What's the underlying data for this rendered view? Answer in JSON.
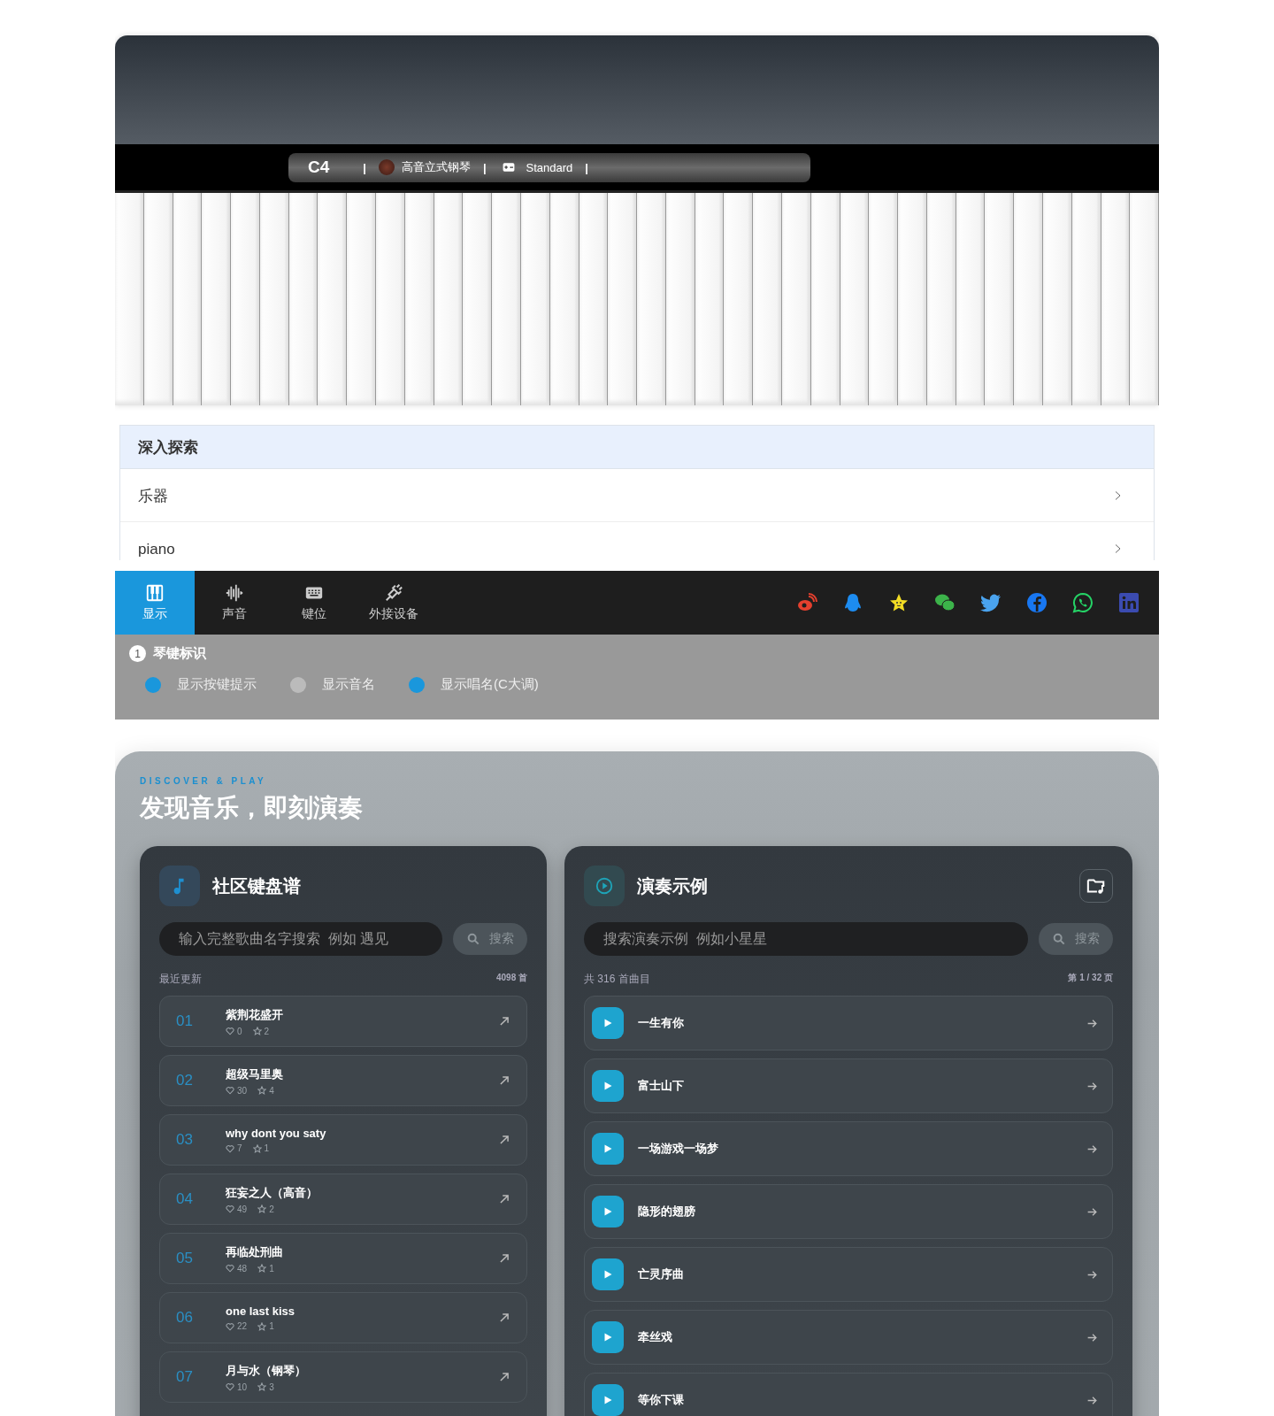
{
  "piano": {
    "status": {
      "note": "C4",
      "instrument": "高音立式钢琴",
      "keymap": "Standard",
      "separator": "|"
    }
  },
  "explore": {
    "title": "深入探索",
    "items": [
      "乐器",
      "piano"
    ]
  },
  "toolbar": {
    "tabs": [
      {
        "label": "显示",
        "kind": "piano",
        "selected": true
      },
      {
        "label": "声音",
        "kind": "wave",
        "selected": false
      },
      {
        "label": "键位",
        "kind": "keyboard",
        "selected": false
      },
      {
        "label": "外接设备",
        "kind": "plug",
        "selected": false
      }
    ]
  },
  "display_settings": {
    "step": "1",
    "title": "琴键标识",
    "options": [
      {
        "label": "显示按键提示",
        "on": true
      },
      {
        "label": "显示音名",
        "on": false
      },
      {
        "label": "显示唱名(C大调)",
        "on": true
      }
    ]
  },
  "discover": {
    "eyebrow": "DISCOVER & PLAY",
    "title": "发现音乐，即刻演奏",
    "community": {
      "title": "社区键盘谱",
      "placeholder": "输入完整歌曲名字搜索  例如 遇见",
      "search_button": "搜索",
      "list_label": "最近更新",
      "count": "4098 首",
      "items": [
        {
          "rank": "01",
          "title": "紫荆花盛开",
          "likes": "0",
          "favorites": "2"
        },
        {
          "rank": "02",
          "title": "超级马里奥",
          "likes": "30",
          "favorites": "4"
        },
        {
          "rank": "03",
          "title": "why dont you saty",
          "likes": "7",
          "favorites": "1"
        },
        {
          "rank": "04",
          "title": "狂妄之人（高音）",
          "likes": "49",
          "favorites": "2"
        },
        {
          "rank": "05",
          "title": "再临处刑曲",
          "likes": "48",
          "favorites": "1"
        },
        {
          "rank": "06",
          "title": "one last kiss",
          "likes": "22",
          "favorites": "1"
        },
        {
          "rank": "07",
          "title": "月与水（钢琴）",
          "likes": "10",
          "favorites": "3"
        }
      ]
    },
    "examples": {
      "title": "演奏示例",
      "placeholder": "搜索演奏示例  例如小星星",
      "search_button": "搜索",
      "total": "共 316 首曲目",
      "page": "第 1 / 32 页",
      "items": [
        "一生有你",
        "富士山下",
        "一场游戏一场梦",
        "隐形的翅膀",
        "亡灵序曲",
        "牵丝戏",
        "等你下课"
      ]
    }
  }
}
